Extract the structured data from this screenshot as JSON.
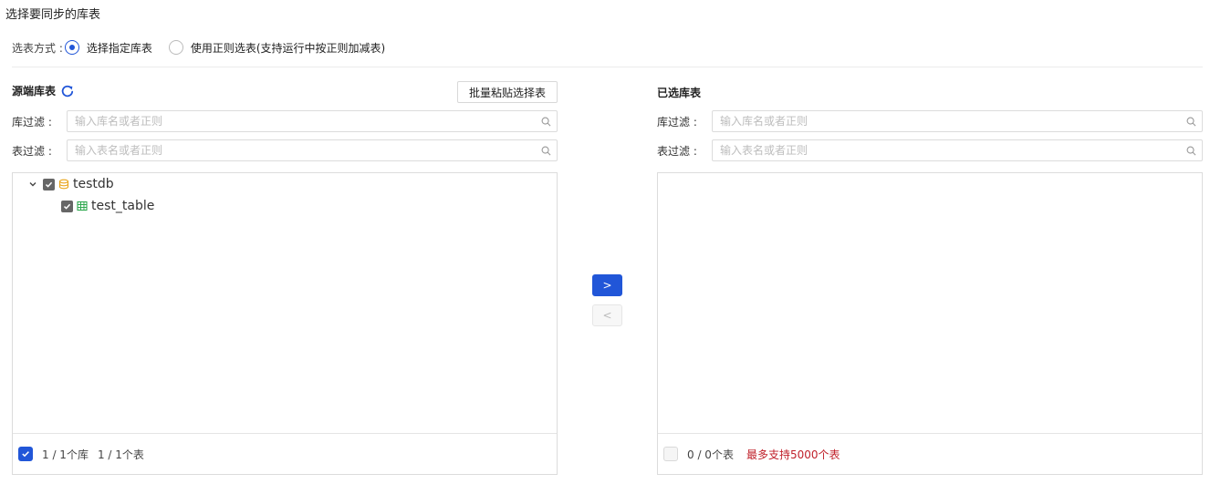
{
  "page": {
    "title": "选择要同步的库表"
  },
  "mode": {
    "label": "选表方式 :",
    "options": [
      {
        "label": "选择指定库表",
        "checked": true
      },
      {
        "label": "使用正则选表(支持运行中按正则加减表)",
        "checked": false
      }
    ]
  },
  "source": {
    "title": "源端库表",
    "paste_button": "批量粘贴选择表",
    "db_filter_label": "库过滤 :",
    "db_filter_placeholder": "输入库名或者正则",
    "table_filter_label": "表过滤 :",
    "table_filter_placeholder": "输入表名或者正则",
    "tree": [
      {
        "name": "testdb",
        "type": "database",
        "checked": true,
        "expanded": true,
        "children": [
          {
            "name": "test_table",
            "type": "table",
            "checked": true
          }
        ]
      }
    ],
    "footer": {
      "db_count": "1 / 1个库",
      "table_count": "1 / 1个表"
    }
  },
  "transfer": {
    "right_label": ">",
    "left_label": "<"
  },
  "selected": {
    "title": "已选库表",
    "db_filter_label": "库过滤 :",
    "db_filter_placeholder": "输入库名或者正则",
    "table_filter_label": "表过滤 :",
    "table_filter_placeholder": "输入表名或者正则",
    "footer": {
      "table_count": "0 / 0个表",
      "limit_note": "最多支持5000个表"
    }
  },
  "colors": {
    "primary": "#2156d8",
    "warning_text": "#c0202a",
    "db_icon": "#e8a317",
    "table_icon": "#2fa84f",
    "refresh_icon": "#2156d8"
  }
}
